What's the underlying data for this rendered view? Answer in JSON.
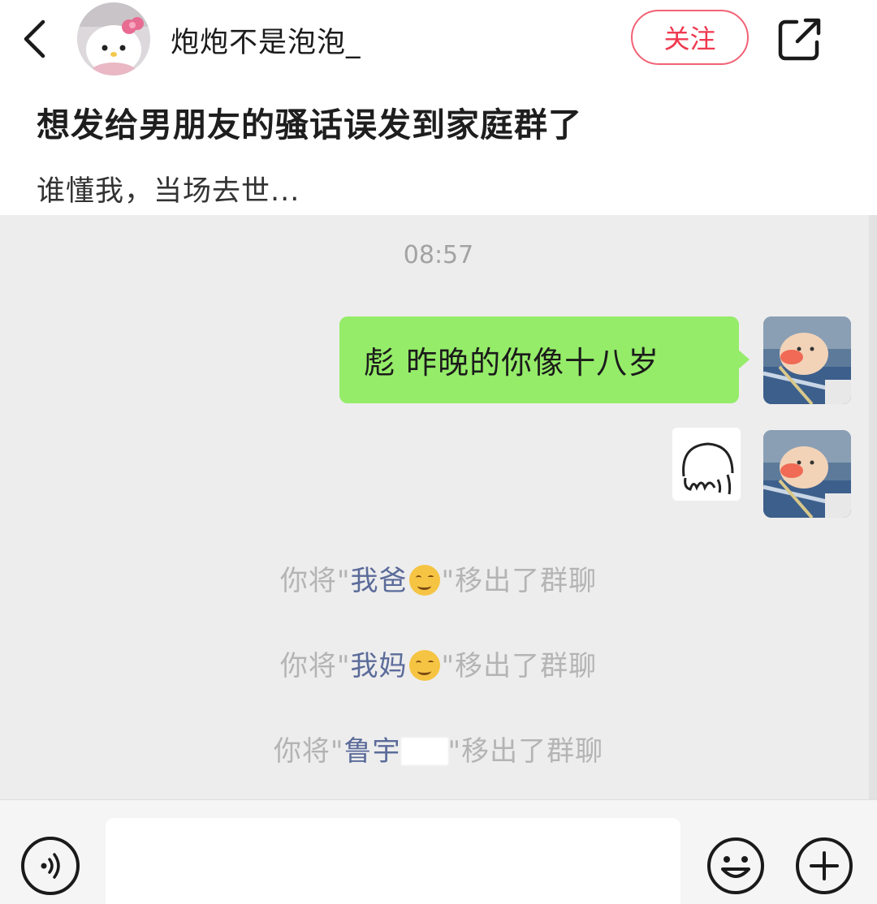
{
  "header": {
    "username": "炮炮不是泡泡_",
    "follow_label": "关注",
    "back_icon": "chevron-left-icon",
    "share_icon": "share-icon"
  },
  "post": {
    "title": "想发给男朋友的骚话误发到家庭群了",
    "body": "谁懂我，当场去世..."
  },
  "chat": {
    "timestamp": "08:57",
    "message": "彪 昨晚的你像十八岁",
    "bubble_color": "#95ec69",
    "system_messages": [
      {
        "prefix": "你将\"",
        "name": "我爸",
        "suffix": "\"移出了群聊"
      },
      {
        "prefix": "你将\"",
        "name": "我妈",
        "suffix": "\"移出了群聊"
      },
      {
        "prefix": "你将\"",
        "name": "鲁宇",
        "suffix": "\"移出了群聊"
      }
    ],
    "name_color": "#5b6b9a"
  },
  "inputbar": {
    "placeholder": "",
    "voice_icon": "voice-icon",
    "emoji_icon": "emoji-icon",
    "plus_icon": "plus-icon"
  }
}
